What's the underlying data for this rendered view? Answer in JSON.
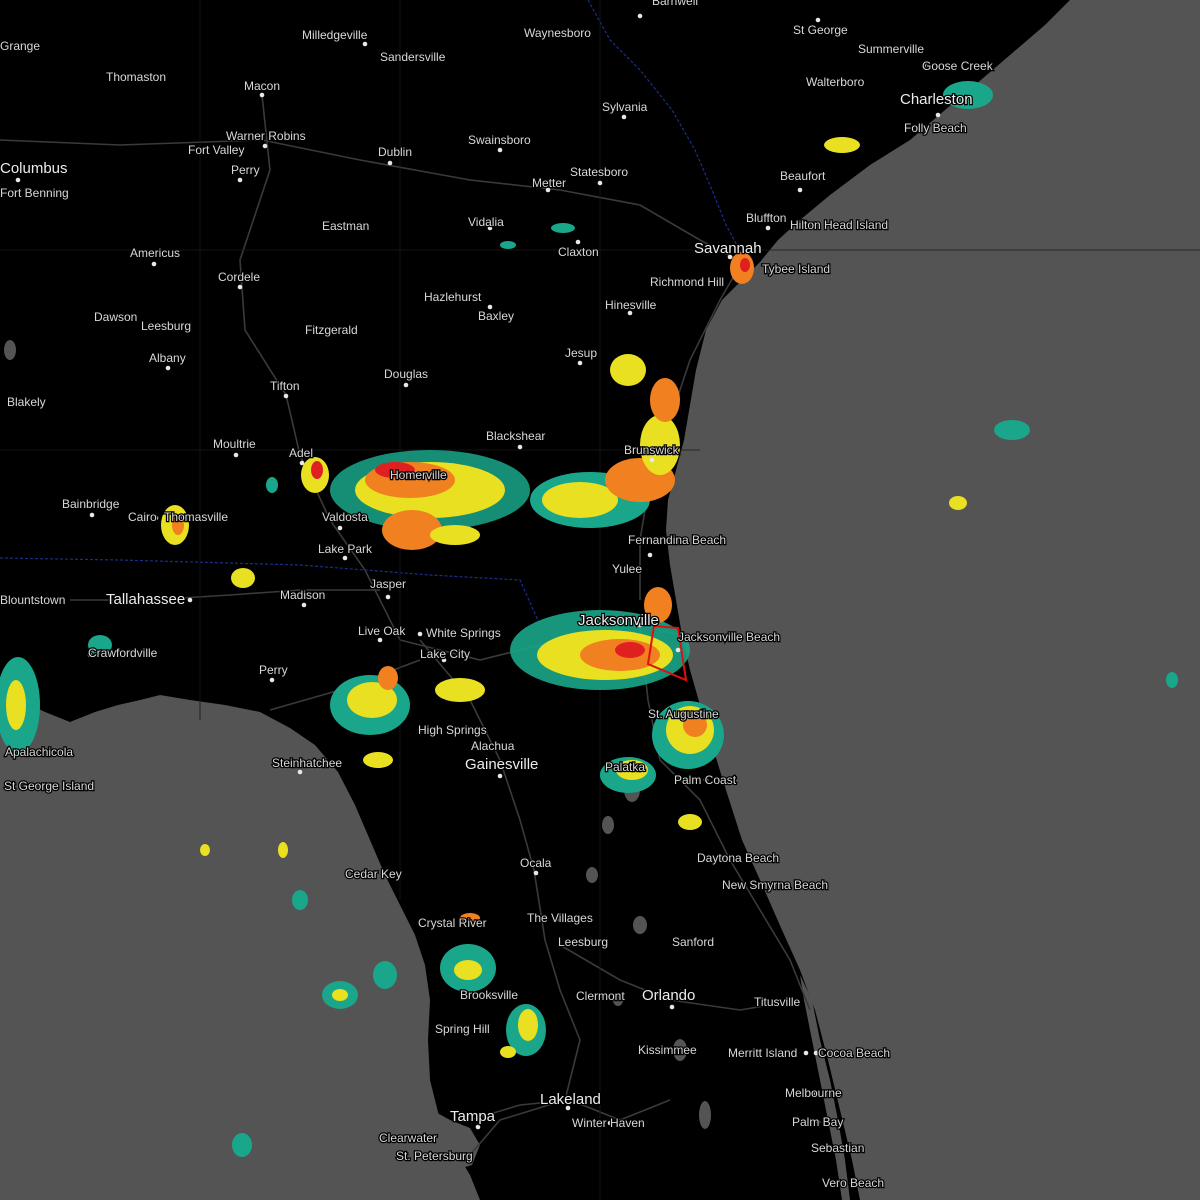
{
  "map": {
    "type": "weather-radar",
    "colors": {
      "land": "#000000",
      "water": "#545454",
      "roads": "#3a3a3a",
      "state_border": "#1b2f8a",
      "warning_polygon": "#e01010",
      "radar_light": "#1aa68a",
      "radar_mid": "#e8e020",
      "radar_high": "#f08020",
      "radar_severe": "#e02020"
    },
    "warning": {
      "shape": "polygon",
      "color": "red",
      "near": "Jacksonville Beach"
    },
    "cities": [
      {
        "name": "Grange"
      },
      {
        "name": "Thomaston"
      },
      {
        "name": "Milledgeville"
      },
      {
        "name": "Sandersville"
      },
      {
        "name": "Waynesboro"
      },
      {
        "name": "Barnwell"
      },
      {
        "name": "St George"
      },
      {
        "name": "Summerville"
      },
      {
        "name": "Goose Creek"
      },
      {
        "name": "Walterboro"
      },
      {
        "name": "Charleston"
      },
      {
        "name": "Folly Beach"
      },
      {
        "name": "Macon"
      },
      {
        "name": "Sylvania"
      },
      {
        "name": "Warner Robins"
      },
      {
        "name": "Swainsboro"
      },
      {
        "name": "Fort Valley"
      },
      {
        "name": "Dublin"
      },
      {
        "name": "Statesboro"
      },
      {
        "name": "Beaufort"
      },
      {
        "name": "Columbus"
      },
      {
        "name": "Perry"
      },
      {
        "name": "Metter"
      },
      {
        "name": "Fort Benning"
      },
      {
        "name": "Bluffton"
      },
      {
        "name": "Hilton Head Island"
      },
      {
        "name": "Eastman"
      },
      {
        "name": "Vidalia"
      },
      {
        "name": "Americus"
      },
      {
        "name": "Claxton"
      },
      {
        "name": "Savannah"
      },
      {
        "name": "Tybee Island"
      },
      {
        "name": "Cordele"
      },
      {
        "name": "Richmond Hill"
      },
      {
        "name": "Hazlehurst"
      },
      {
        "name": "Dawson"
      },
      {
        "name": "Baxley"
      },
      {
        "name": "Hinesville"
      },
      {
        "name": "Leesburg"
      },
      {
        "name": "Fitzgerald"
      },
      {
        "name": "Albany"
      },
      {
        "name": "Jesup"
      },
      {
        "name": "Douglas"
      },
      {
        "name": "Tifton"
      },
      {
        "name": "Blakely"
      },
      {
        "name": "Blackshear"
      },
      {
        "name": "Brunswick"
      },
      {
        "name": "Moultrie"
      },
      {
        "name": "Adel"
      },
      {
        "name": "Homerville"
      },
      {
        "name": "Bainbridge"
      },
      {
        "name": "Cairo"
      },
      {
        "name": "Thomasville"
      },
      {
        "name": "Valdosta"
      },
      {
        "name": "Fernandina Beach"
      },
      {
        "name": "Lake Park"
      },
      {
        "name": "Yulee"
      },
      {
        "name": "Jasper"
      },
      {
        "name": "Blountstown"
      },
      {
        "name": "Tallahassee"
      },
      {
        "name": "Madison"
      },
      {
        "name": "Jacksonville"
      },
      {
        "name": "Live Oak"
      },
      {
        "name": "White Springs"
      },
      {
        "name": "Jacksonville Beach"
      },
      {
        "name": "Lake City"
      },
      {
        "name": "Crawfordville"
      },
      {
        "name": "Perry"
      },
      {
        "name": "St. Augustine"
      },
      {
        "name": "High Springs"
      },
      {
        "name": "Alachua"
      },
      {
        "name": "Palm Coast"
      },
      {
        "name": "Apalachicola"
      },
      {
        "name": "Steinhatchee"
      },
      {
        "name": "Gainesville"
      },
      {
        "name": "St George Island"
      },
      {
        "name": "Palatka"
      },
      {
        "name": "Daytona Beach"
      },
      {
        "name": "Ocala"
      },
      {
        "name": "Cedar Key"
      },
      {
        "name": "New Smyrna Beach"
      },
      {
        "name": "Crystal River"
      },
      {
        "name": "The Villages"
      },
      {
        "name": "Sanford"
      },
      {
        "name": "Leesburg"
      },
      {
        "name": "Orlando"
      },
      {
        "name": "Titusville"
      },
      {
        "name": "Brooksville"
      },
      {
        "name": "Clermont"
      },
      {
        "name": "Spring Hill"
      },
      {
        "name": "Kissimmee"
      },
      {
        "name": "Merritt Island"
      },
      {
        "name": "Cocoa Beach"
      },
      {
        "name": "Melbourne"
      },
      {
        "name": "Lakeland"
      },
      {
        "name": "Palm Bay"
      },
      {
        "name": "Tampa"
      },
      {
        "name": "Winter Haven"
      },
      {
        "name": "Clearwater"
      },
      {
        "name": "Sebastian"
      },
      {
        "name": "St. Petersburg"
      },
      {
        "name": "Vero Beach"
      }
    ]
  }
}
